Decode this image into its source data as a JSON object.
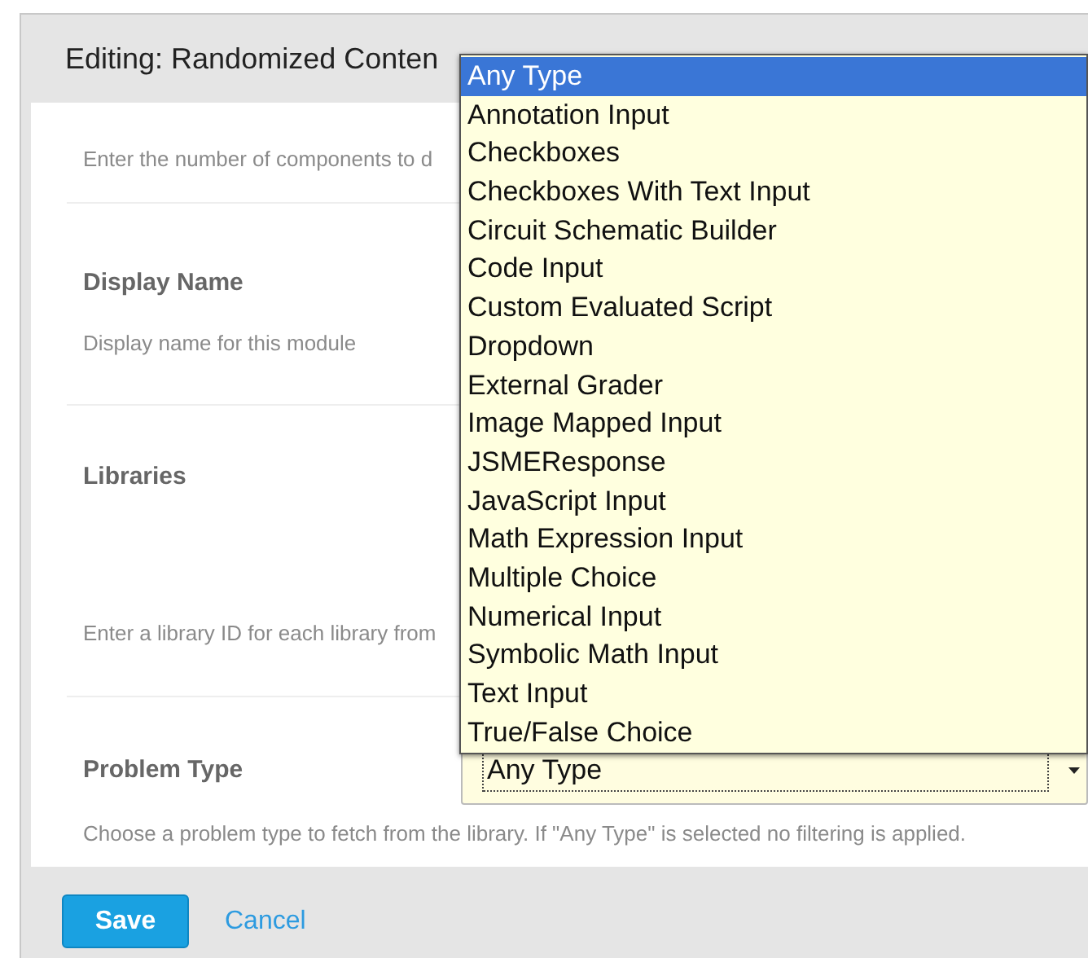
{
  "dialog": {
    "title": "Editing: Randomized Conten"
  },
  "fields": [
    {
      "kind": "number",
      "help": "Enter the number of components to d"
    },
    {
      "kind": "text",
      "label": "Display Name",
      "help": "Display name for this module"
    },
    {
      "kind": "list",
      "label": "Libraries",
      "help": "Enter a library ID for each library from"
    },
    {
      "kind": "select",
      "label": "Problem Type",
      "value": "Any Type",
      "help": "Choose a problem type to fetch from the library. If \"Any Type\" is selected no filtering is applied."
    }
  ],
  "dropdown": {
    "options": [
      {
        "label": "Any Type",
        "selected": true
      },
      {
        "label": "Annotation Input",
        "selected": false
      },
      {
        "label": "Checkboxes",
        "selected": false
      },
      {
        "label": "Checkboxes With Text Input",
        "selected": false
      },
      {
        "label": "Circuit Schematic Builder",
        "selected": false
      },
      {
        "label": "Code Input",
        "selected": false
      },
      {
        "label": "Custom Evaluated Script",
        "selected": false
      },
      {
        "label": "Dropdown",
        "selected": false
      },
      {
        "label": "External Grader",
        "selected": false
      },
      {
        "label": "Image Mapped Input",
        "selected": false
      },
      {
        "label": "JSMEResponse",
        "selected": false
      },
      {
        "label": "JavaScript Input",
        "selected": false
      },
      {
        "label": "Math Expression Input",
        "selected": false
      },
      {
        "label": "Multiple Choice",
        "selected": false
      },
      {
        "label": "Numerical Input",
        "selected": false
      },
      {
        "label": "Symbolic Math Input",
        "selected": false
      },
      {
        "label": "Text Input",
        "selected": false
      },
      {
        "label": "True/False Choice",
        "selected": false
      }
    ]
  },
  "buttons": {
    "save": "Save",
    "cancel": "Cancel"
  }
}
